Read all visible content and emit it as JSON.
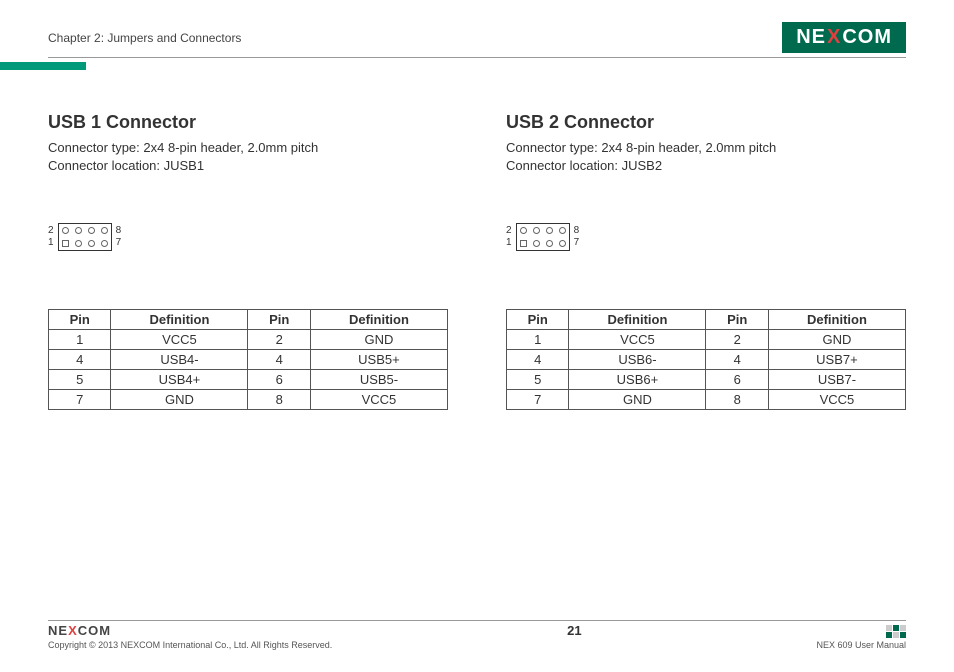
{
  "header": {
    "chapter": "Chapter 2: Jumpers and Connectors",
    "brand_pre": "NE",
    "brand_x": "X",
    "brand_post": "COM"
  },
  "left": {
    "title": "USB 1 Connector",
    "type_line": "Connector type: 2x4 8-pin header, 2.0mm pitch",
    "loc_line": "Connector location: JUSB1",
    "pin_labels": {
      "top_left": "2",
      "bot_left": "1",
      "top_right": "8",
      "bot_right": "7"
    },
    "table": {
      "headers": [
        "Pin",
        "Definition",
        "Pin",
        "Definition"
      ],
      "rows": [
        [
          "1",
          "VCC5",
          "2",
          "GND"
        ],
        [
          "4",
          "USB4-",
          "4",
          "USB5+"
        ],
        [
          "5",
          "USB4+",
          "6",
          "USB5-"
        ],
        [
          "7",
          "GND",
          "8",
          "VCC5"
        ]
      ]
    }
  },
  "right": {
    "title": "USB 2 Connector",
    "type_line": "Connector type: 2x4 8-pin header, 2.0mm pitch",
    "loc_line": "Connector location: JUSB2",
    "pin_labels": {
      "top_left": "2",
      "bot_left": "1",
      "top_right": "8",
      "bot_right": "7"
    },
    "table": {
      "headers": [
        "Pin",
        "Definition",
        "Pin",
        "Definition"
      ],
      "rows": [
        [
          "1",
          "VCC5",
          "2",
          "GND"
        ],
        [
          "4",
          "USB6-",
          "4",
          "USB7+"
        ],
        [
          "5",
          "USB6+",
          "6",
          "USB7-"
        ],
        [
          "7",
          "GND",
          "8",
          "VCC5"
        ]
      ]
    }
  },
  "footer": {
    "brand_pre": "NE",
    "brand_x": "X",
    "brand_post": "COM",
    "copyright": "Copyright © 2013 NEXCOM International Co., Ltd. All Rights Reserved.",
    "page": "21",
    "manual": "NEX 609 User Manual"
  }
}
